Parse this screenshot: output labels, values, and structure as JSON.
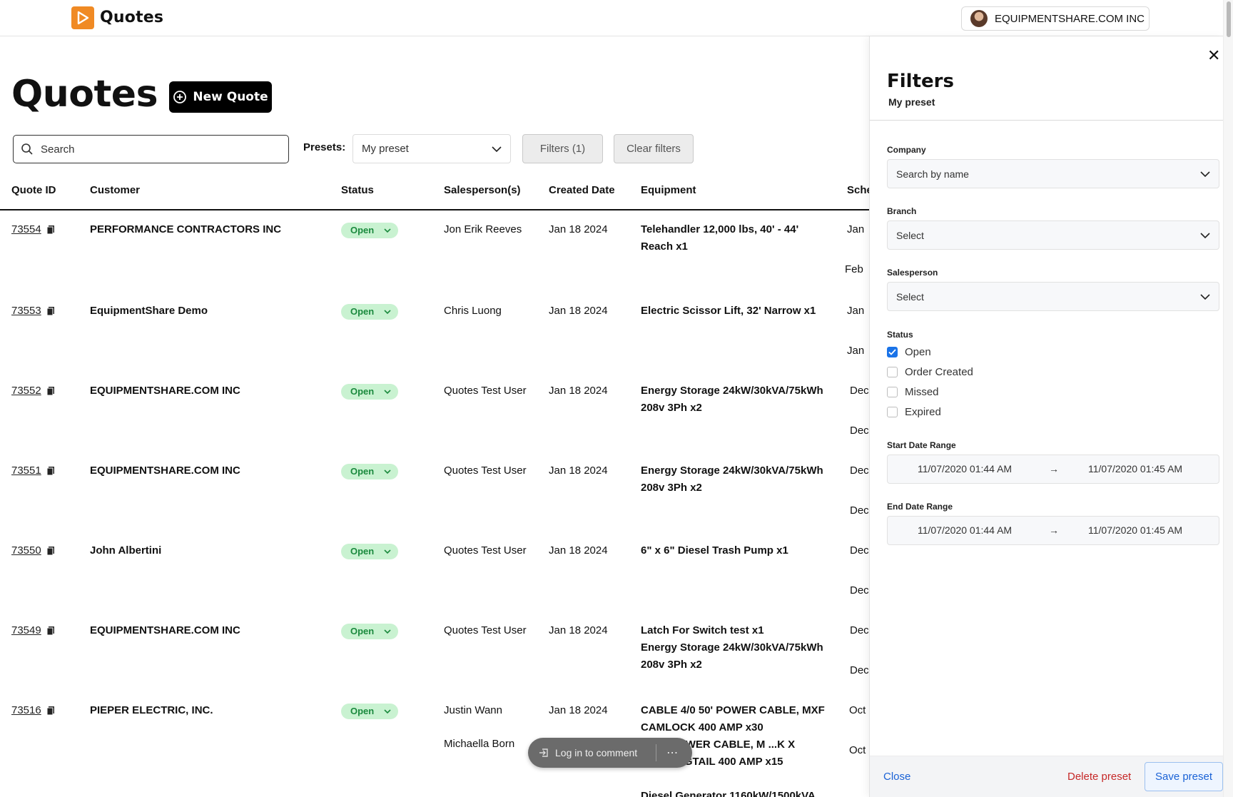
{
  "app": {
    "title": "Quotes",
    "account_name": "EQUIPMENTSHARE.COM INC"
  },
  "page": {
    "title": "Quotes",
    "new_quote_label": "New Quote"
  },
  "search": {
    "placeholder": "Search"
  },
  "presets": {
    "label": "Presets:",
    "selected": "My preset"
  },
  "toolbar": {
    "filters_label": "Filters (1)",
    "clear_label": "Clear filters"
  },
  "table": {
    "columns": [
      "Quote ID",
      "Customer",
      "Status",
      "Salesperson(s)",
      "Created Date",
      "Equipment",
      "Sche"
    ],
    "rows": [
      {
        "id": "73554",
        "customer": "PERFORMANCE CONTRACTORS INC",
        "status": "Open",
        "sales1": "Jon Erik Reeves",
        "sales2": "",
        "created": "Jan 18 2024",
        "equip1": "Telehandler 12,000 lbs, 40' - 44' Reach x1",
        "equip2": "",
        "sched1": "Jan",
        "sched2": "Feb"
      },
      {
        "id": "73553",
        "customer": "EquipmentShare Demo",
        "status": "Open",
        "sales1": "Chris Luong",
        "sales2": "",
        "created": "Jan 18 2024",
        "equip1": "Electric Scissor Lift, 32' Narrow x1",
        "equip2": "",
        "sched1": "Jan",
        "sched2": "Jan"
      },
      {
        "id": "73552",
        "customer": "EQUIPMENTSHARE.COM INC",
        "status": "Open",
        "sales1": "Quotes Test User",
        "sales2": "",
        "created": "Jan 18 2024",
        "equip1": "Energy Storage 24kW/30kVA/75kWh 208v 3Ph x2",
        "equip2": "",
        "sched1": "Dec",
        "sched2": "Dec"
      },
      {
        "id": "73551",
        "customer": "EQUIPMENTSHARE.COM INC",
        "status": "Open",
        "sales1": "Quotes Test User",
        "sales2": "",
        "created": "Jan 18 2024",
        "equip1": "Energy Storage 24kW/30kVA/75kWh 208v 3Ph x2",
        "equip2": "",
        "sched1": "Dec",
        "sched2": "Dec"
      },
      {
        "id": "73550",
        "customer": "John Albertini",
        "status": "Open",
        "sales1": "Quotes Test User",
        "sales2": "",
        "created": "Jan 18 2024",
        "equip1": "6\" x 6\" Diesel Trash Pump x1",
        "equip2": "",
        "sched1": "Dec",
        "sched2": "Dec"
      },
      {
        "id": "73549",
        "customer": "EQUIPMENTSHARE.COM INC",
        "status": "Open",
        "sales1": "Quotes Test User",
        "sales2": "",
        "created": "Jan 18 2024",
        "equip1": "Latch For Switch test x1",
        "equip2": "Energy Storage 24kW/30kVA/75kWh 208v 3Ph x2",
        "sched1": "Dec",
        "sched2": "Dec"
      },
      {
        "id": "73516",
        "customer": "PIEPER ELECTRIC, INC.",
        "status": "Open",
        "sales1": "Justin Wann",
        "sales2": "Michaella Born",
        "created": "Jan 18 2024",
        "equip1": "CABLE 4/0 50' POWER CABLE, MXF CAMLOCK 400 AMP x30",
        "equip2": "...0 5' POWER CABLE, M ...K X BARE PIGTAIL 400 AMP x15",
        "equip3": "Diesel Generator 1160kW/1500kVA",
        "sched1": "Oct",
        "sched2": "Oct"
      }
    ]
  },
  "comment": {
    "label": "Log in to comment"
  },
  "filters_panel": {
    "title": "Filters",
    "subtitle": "My preset",
    "company_label": "Company",
    "company_placeholder": "Search by name",
    "branch_label": "Branch",
    "branch_value": "Select",
    "salesperson_label": "Salesperson",
    "salesperson_value": "Select",
    "status_label": "Status",
    "status_options": [
      {
        "label": "Open",
        "checked": true
      },
      {
        "label": "Order Created",
        "checked": false
      },
      {
        "label": "Missed",
        "checked": false
      },
      {
        "label": "Expired",
        "checked": false
      }
    ],
    "start_label": "Start Date Range",
    "start_from": "11/07/2020 01:44 AM",
    "start_to": "11/07/2020 01:45 AM",
    "end_label": "End Date Range",
    "end_from": "11/07/2020 01:44 AM",
    "end_to": "11/07/2020 01:45 AM",
    "close_label": "Close",
    "delete_label": "Delete preset",
    "save_label": "Save preset"
  },
  "colors": {
    "brand": "#f08a24",
    "status_bg": "#c9f2d1",
    "status_fg": "#1b8a3e",
    "link_blue": "#1a62d6",
    "danger": "#c62828",
    "checkbox_blue": "#1a73e8"
  }
}
